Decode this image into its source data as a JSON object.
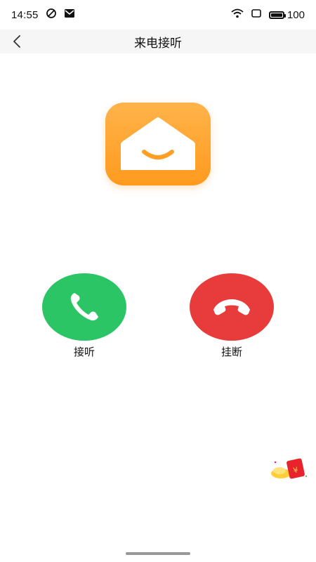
{
  "status_bar": {
    "time": "14:55",
    "battery": "100",
    "icons": [
      "alarm-icon",
      "mail-icon",
      "wifi-icon",
      "sim-icon",
      "battery-icon"
    ]
  },
  "header": {
    "title": "来电接听",
    "back_icon": "back-arrow-icon"
  },
  "app": {
    "icon": "home-smile-icon",
    "accent": "#ff9f26"
  },
  "actions": {
    "answer_label": "接听",
    "answer_color": "#2cc566",
    "hangup_label": "挂断",
    "hangup_color": "#e83c3c"
  },
  "floating": {
    "red_packet_icon": "red-envelope-icon",
    "red_packet_symbol": "¥"
  }
}
